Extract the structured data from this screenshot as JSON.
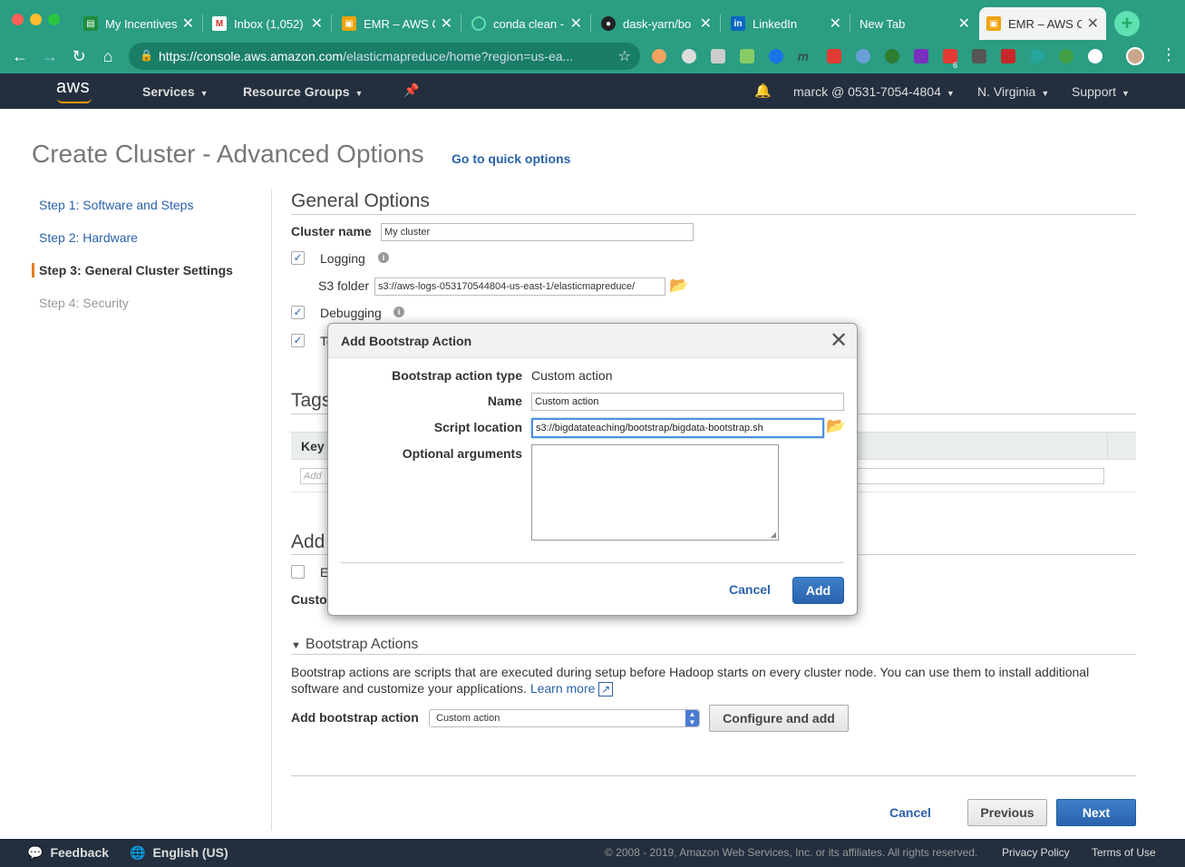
{
  "browser": {
    "tabs": [
      {
        "title": "My Incentives",
        "icon": "sheets-icon",
        "color": "#1e8e3e"
      },
      {
        "title": "Inbox (1,052)",
        "icon": "gmail-icon",
        "color": "#ffffff"
      },
      {
        "title": "EMR – AWS C",
        "icon": "aws-box-icon",
        "color": "#f0a30a"
      },
      {
        "title": "conda clean -",
        "icon": "loading-icon",
        "color": "#5ee0b1"
      },
      {
        "title": "dask-yarn/bo",
        "icon": "github-icon",
        "color": "#222222"
      },
      {
        "title": "LinkedIn",
        "icon": "linkedin-icon",
        "color": "#0a66c2"
      },
      {
        "title": "New Tab",
        "icon": "",
        "color": ""
      },
      {
        "title": "EMR – AWS C",
        "icon": "aws-box-icon",
        "color": "#f0a30a"
      }
    ],
    "url_host": "https://console.aws.amazon.com",
    "url_path": "/elasticmapreduce/home?region=us-ea...",
    "ext_badge": "6"
  },
  "aws_nav": {
    "logo": "aws",
    "services": "Services",
    "resource_groups": "Resource Groups",
    "account": "marck @ 0531-7054-4804",
    "region": "N. Virginia",
    "support": "Support"
  },
  "page": {
    "title": "Create Cluster - Advanced Options",
    "quick_link": "Go to quick options"
  },
  "steps": [
    "Step 1: Software and Steps",
    "Step 2: Hardware",
    "Step 3: General Cluster Settings",
    "Step 4: Security"
  ],
  "general": {
    "heading": "General Options",
    "cluster_name_label": "Cluster name",
    "cluster_name_value": "My cluster",
    "logging_label": "Logging",
    "s3_folder_label": "S3 folder",
    "s3_folder_value": "s3://aws-logs-053170544804-us-east-1/elasticmapreduce/",
    "debugging_label": "Debugging",
    "third_row_fragment": "Te"
  },
  "tags": {
    "heading_fragment": "Tags",
    "key_header": "Key",
    "add_placeholder_fragment": "Add"
  },
  "additional": {
    "heading_fragment": "Add",
    "checkbox_fragment": "E",
    "custom_fragment": "Custo"
  },
  "bootstrap": {
    "heading": "Bootstrap Actions",
    "desc": "Bootstrap actions are scripts that are executed during setup before Hadoop starts on every cluster node. You can use them to install additional software and customize your applications.",
    "learn_more": "Learn more",
    "add_label": "Add bootstrap action",
    "select_value": "Custom action",
    "configure_button": "Configure and add"
  },
  "bottom_buttons": {
    "cancel": "Cancel",
    "previous": "Previous",
    "next": "Next"
  },
  "modal": {
    "title": "Add Bootstrap Action",
    "type_label": "Bootstrap action type",
    "type_value": "Custom action",
    "name_label": "Name",
    "name_value": "Custom action",
    "script_label": "Script location",
    "script_value": "s3://bigdatateaching/bootstrap/bigdata-bootstrap.sh",
    "args_label": "Optional arguments",
    "cancel": "Cancel",
    "add": "Add"
  },
  "footer": {
    "feedback": "Feedback",
    "language": "English (US)",
    "copyright": "© 2008 - 2019, Amazon Web Services, Inc. or its affiliates. All rights reserved.",
    "privacy": "Privacy Policy",
    "terms": "Terms of Use"
  }
}
